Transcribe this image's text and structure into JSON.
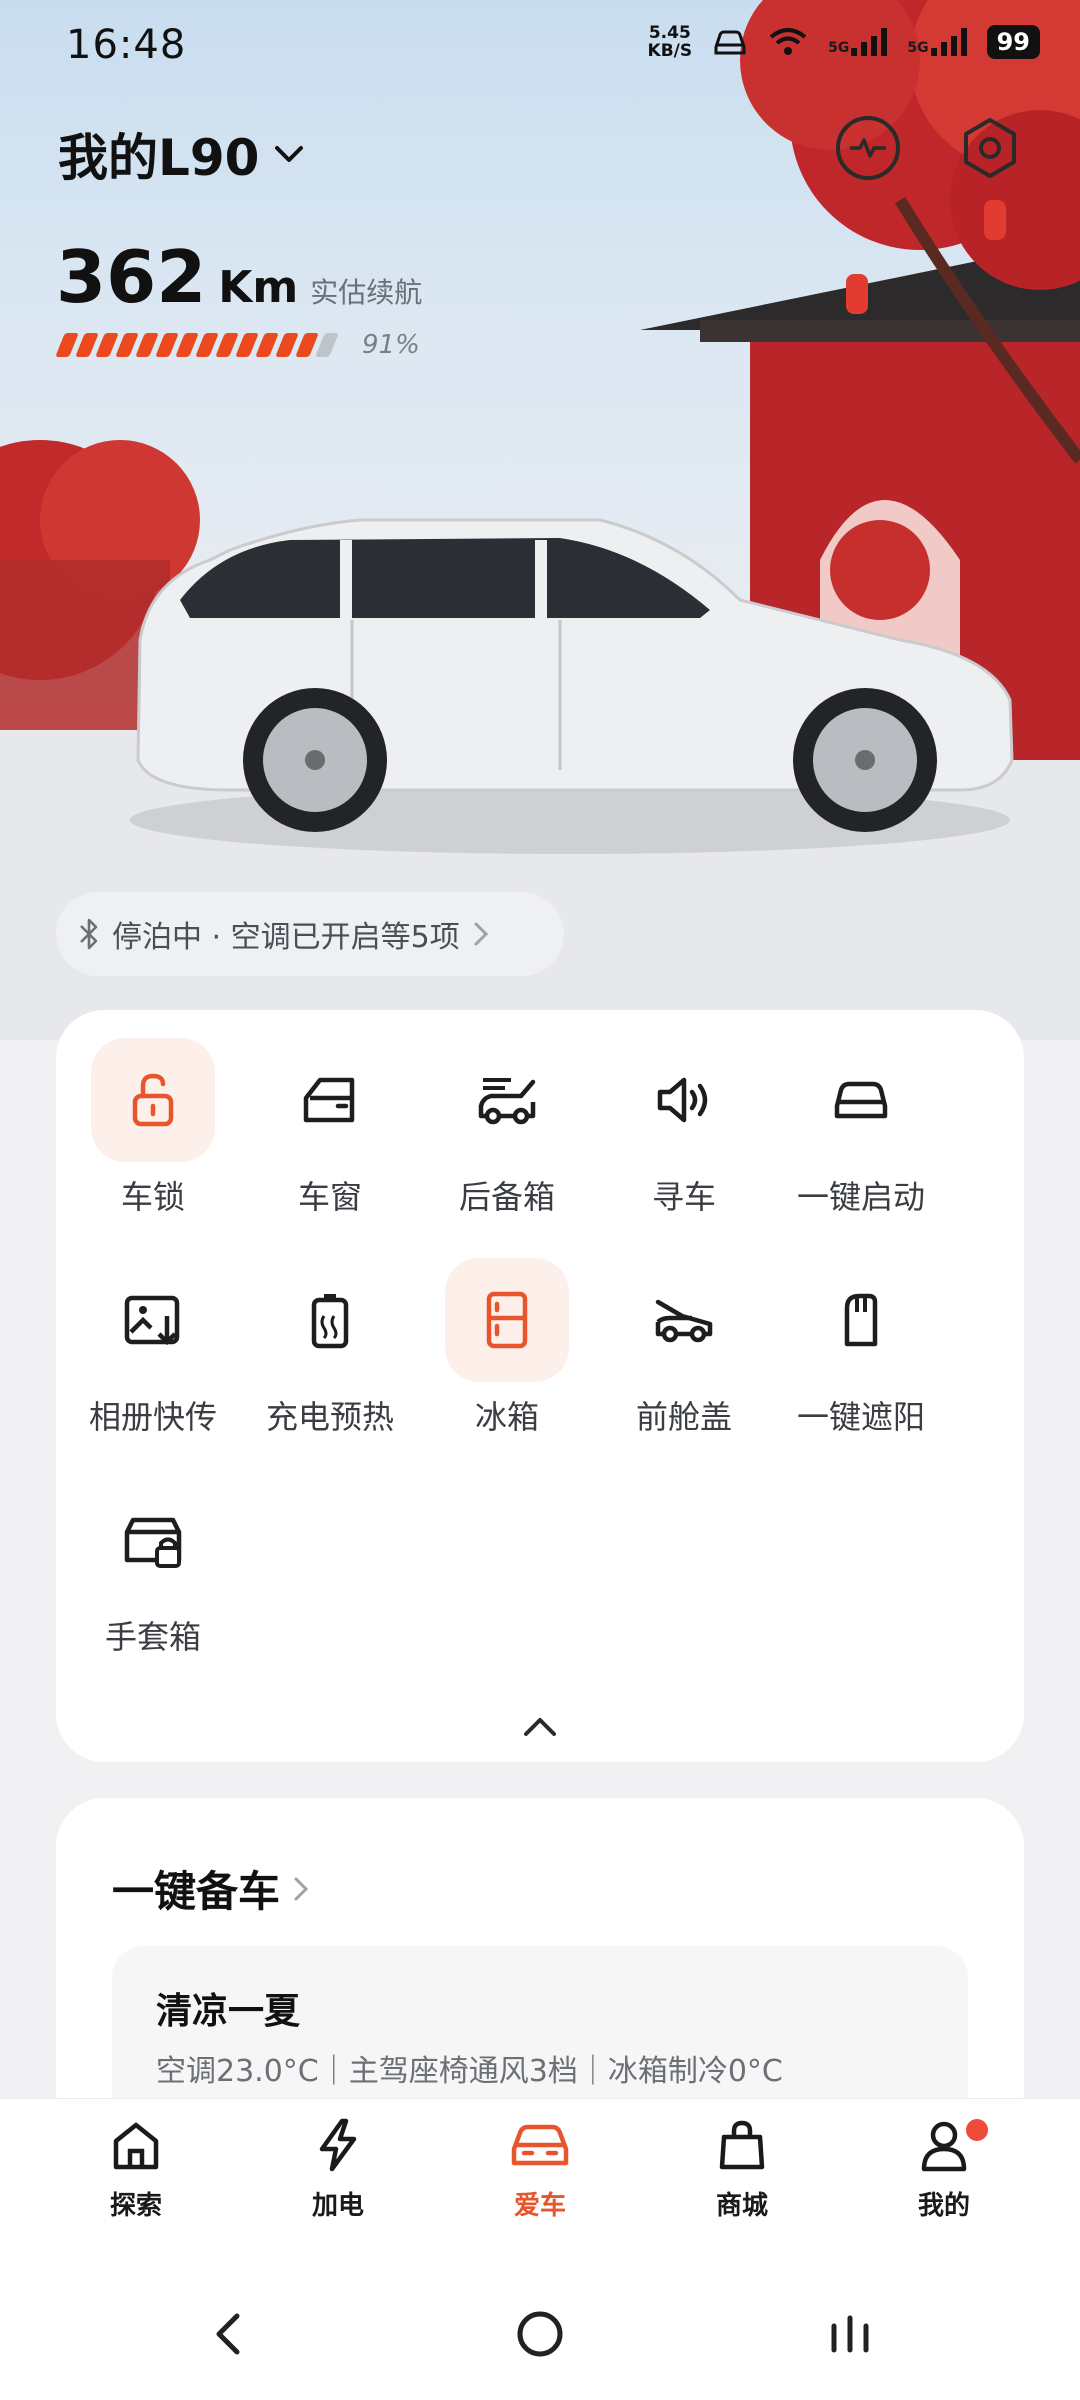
{
  "status_bar": {
    "time": "16:48",
    "net_speed_value": "5.45",
    "net_speed_unit": "KB/S",
    "signal1": "5G",
    "signal2": "5G",
    "battery": "99"
  },
  "header": {
    "car_name": "我的L90",
    "range_value": "362",
    "range_unit": "Km",
    "range_label": "实估续航",
    "battery_percent": "91%",
    "battery_level": 0.91
  },
  "status_pill": {
    "text": "停泊中 · 空调已开启等5项"
  },
  "controls": [
    {
      "label": "车锁",
      "icon": "unlock-icon",
      "active": true
    },
    {
      "label": "车窗",
      "icon": "car-window-icon",
      "active": false
    },
    {
      "label": "后备箱",
      "icon": "trunk-icon",
      "active": false
    },
    {
      "label": "寻车",
      "icon": "speaker-icon",
      "active": false
    },
    {
      "label": "一键启动",
      "icon": "car-start-icon",
      "active": false
    },
    {
      "label": "相册快传",
      "icon": "photo-transfer-icon",
      "active": false
    },
    {
      "label": "充电预热",
      "icon": "battery-heat-icon",
      "active": false
    },
    {
      "label": "冰箱",
      "icon": "fridge-icon",
      "active": true
    },
    {
      "label": "前舱盖",
      "icon": "hood-icon",
      "active": false
    },
    {
      "label": "一键遮阳",
      "icon": "sunshade-icon",
      "active": false
    },
    {
      "label": "手套箱",
      "icon": "glovebox-lock-icon",
      "active": false
    }
  ],
  "scene": {
    "title": "一键备车",
    "preset_title": "清凉一夏",
    "preset_desc": "空调23.0°C｜主驾座椅通风3档｜冰箱制冷0°C"
  },
  "bottom_nav": [
    {
      "label": "探索",
      "icon": "home-icon",
      "active": false
    },
    {
      "label": "加电",
      "icon": "lightning-icon",
      "active": false
    },
    {
      "label": "爱车",
      "icon": "car-icon",
      "active": true
    },
    {
      "label": "商城",
      "icon": "shopping-bag-icon",
      "active": false
    },
    {
      "label": "我的",
      "icon": "person-icon",
      "active": false
    }
  ],
  "colors": {
    "accent": "#e8542b",
    "active_bg": "#fdf0ea",
    "battery_fill": "#ec4a1e"
  }
}
